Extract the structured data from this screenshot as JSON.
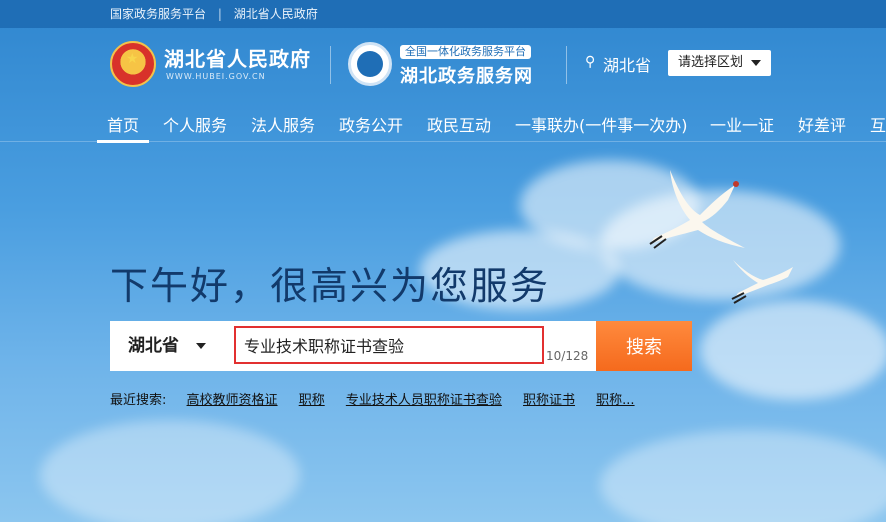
{
  "topbar": {
    "link1": "国家政务服务平台",
    "separator": "|",
    "link2": "湖北省人民政府"
  },
  "header": {
    "site_name": "湖北省人民政府",
    "site_domain": "WWW.HUBEI.GOV.CN",
    "service_tag": "全国一体化政务服务平台",
    "service_name": "湖北政务服务网",
    "location": "湖北省",
    "region_button": "请选择区划"
  },
  "nav": {
    "items": [
      "首页",
      "个人服务",
      "法人服务",
      "政务公开",
      "政民互动",
      "一事联办(一件事一次办)",
      "一业一证",
      "好差评",
      "互"
    ]
  },
  "main": {
    "greeting": "下午好，很高兴为您服务",
    "search": {
      "region": "湖北省",
      "value": "专业技术职称证书查验",
      "counter": "10/128",
      "button": "搜索"
    },
    "recent": {
      "label": "最近搜索:",
      "items": [
        "高校教师资格证",
        "职称",
        "专业技术人员职称证书查验",
        "职称证书",
        "职称..."
      ]
    }
  },
  "colors": {
    "topbar": "#1f6eb6",
    "search_button": "#f56a1d",
    "highlight_border": "#e23030",
    "greeting_text": "#123a6b"
  },
  "icons": [
    "national-emblem-icon",
    "service-logo-icon",
    "location-pin-icon",
    "chevron-down-icon"
  ]
}
